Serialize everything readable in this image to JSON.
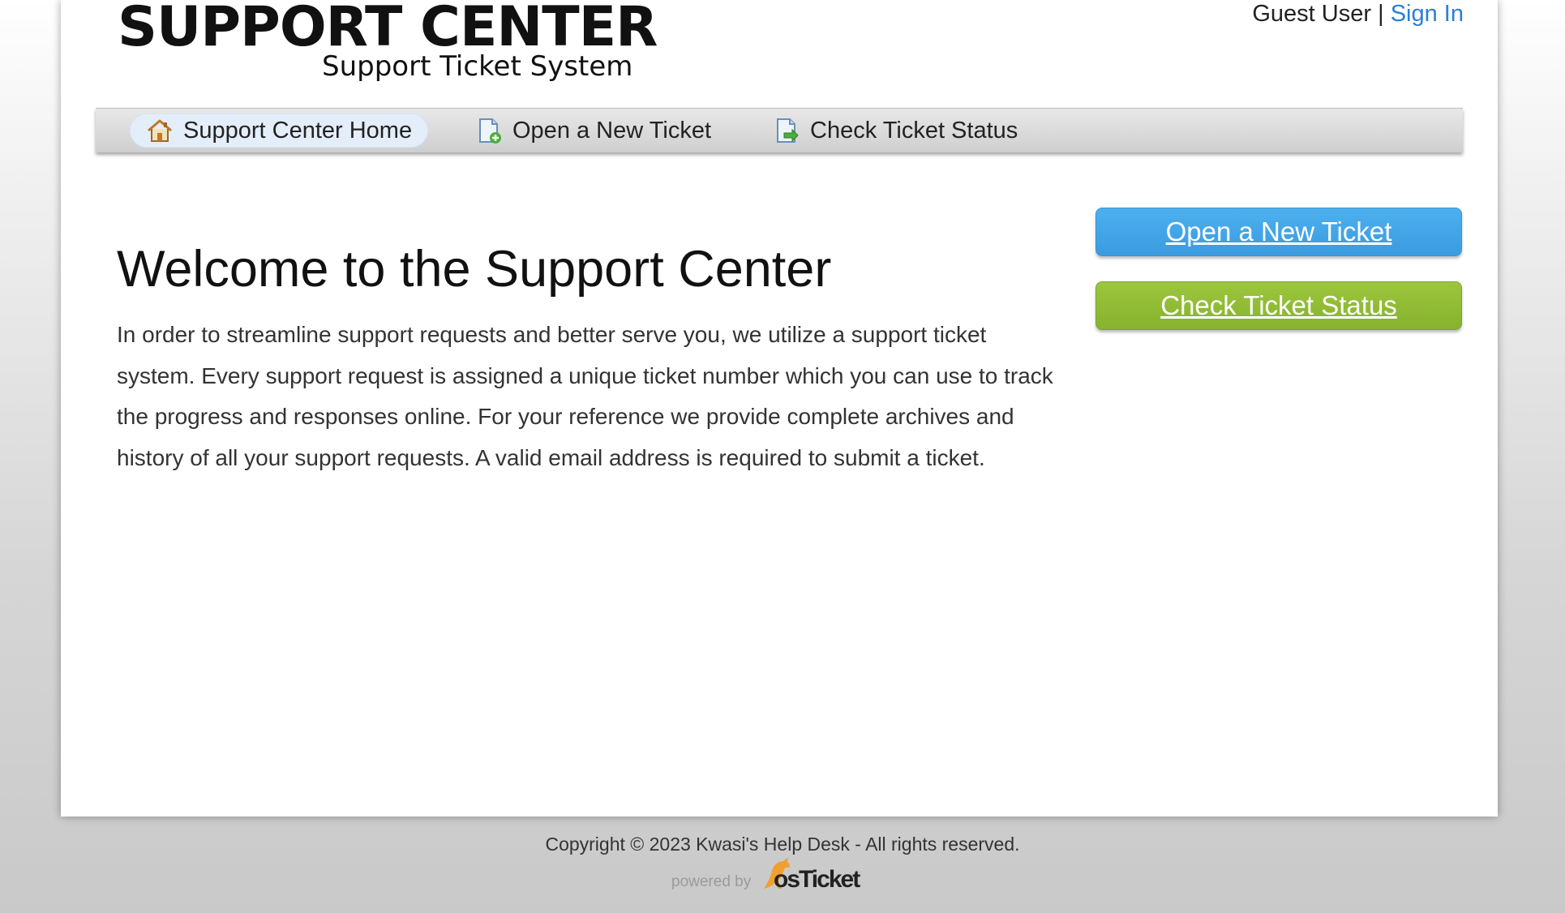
{
  "header": {
    "logo_title": "SUPPORT CENTER",
    "logo_subtitle": "Support Ticket System",
    "user_label": "Guest User",
    "separator": "|",
    "sign_in_label": "Sign In"
  },
  "nav": {
    "items": [
      {
        "label": "Support Center Home",
        "icon": "home-icon",
        "active": true
      },
      {
        "label": "Open a New Ticket",
        "icon": "new-ticket-icon",
        "active": false
      },
      {
        "label": "Check Ticket Status",
        "icon": "ticket-status-icon",
        "active": false
      }
    ]
  },
  "main": {
    "heading": "Welcome to the Support Center",
    "body": "In order to streamline support requests and better serve you, we utilize a support ticket system. Every support request is assigned a unique ticket number which you can use to track the progress and responses online. For your reference we provide complete archives and history of all your support requests. A valid email address is required to submit a ticket."
  },
  "sidebar": {
    "open_ticket_label": "Open a New Ticket",
    "check_status_label": "Check Ticket Status"
  },
  "footer": {
    "copyright": "Copyright © 2023 Kwasi's Help Desk - All rights reserved.",
    "powered_by": "powered by",
    "brand_os": "os",
    "brand_ticket": "Ticket"
  },
  "colors": {
    "accent_blue": "#3a9be0",
    "accent_green": "#86b22e",
    "link_blue": "#2a7fd4"
  }
}
